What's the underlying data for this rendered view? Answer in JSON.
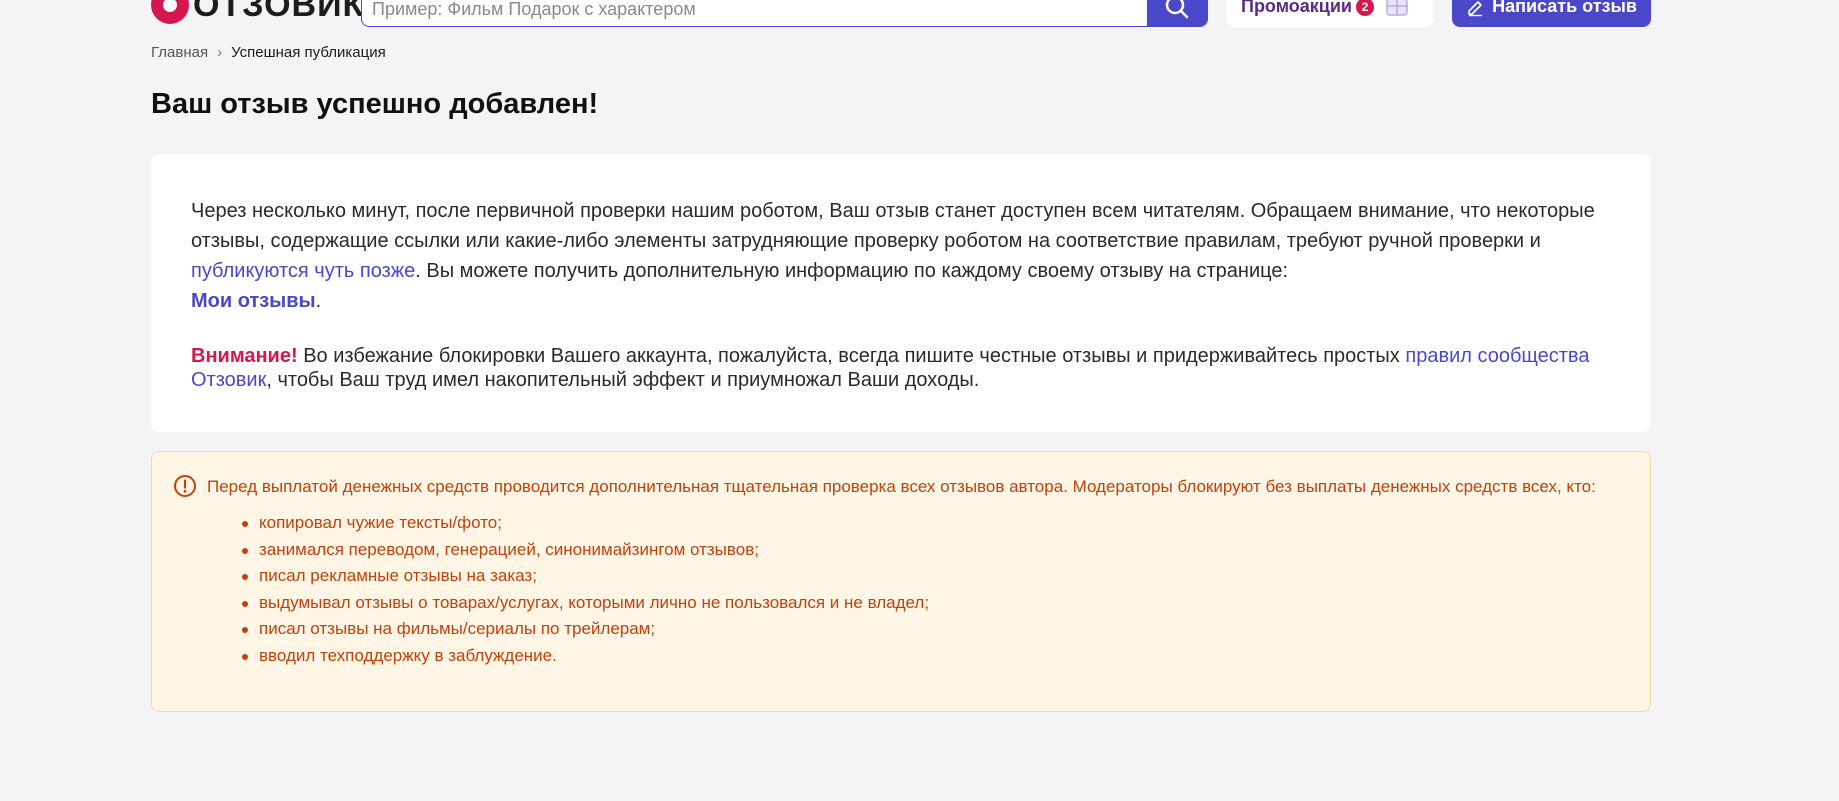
{
  "header": {
    "logo_text": "ОТЗОВИК",
    "search": {
      "placeholder": "Пример: Фильм Подарок с характером",
      "button_icon": "search-icon"
    },
    "promo": {
      "label": "Промоакции",
      "badge_count": "2",
      "icon": "gift-icon"
    },
    "write_button": {
      "label": "Написать отзыв",
      "icon": "pencil-icon"
    }
  },
  "breadcrumb": {
    "home": "Главная",
    "separator": "›",
    "current": "Успешная публикация"
  },
  "page_title": "Ваш отзыв успешно добавлен!",
  "success_card": {
    "para1_text1": "Через несколько минут, после первичной проверки нашим роботом, Ваш отзыв станет доступен всем читателям. Обращаем внимание, что некоторые отзывы, содержащие ссылки или какие-либо элементы затрудняющие проверку роботом на соответствие правилам, требуют ручной проверки и ",
    "para1_link1": "публикуются чуть позже",
    "para1_text2": ". Вы можете получить дополнительную информацию по каждому своему отзыву на странице: ",
    "para1_link2": "Мои отзывы",
    "para1_text3": ".",
    "attention_label": "Внимание!",
    "para2_text1": " Во избежание блокировки Вашего аккаунта, пожалуйста, всегда пишите честные отзывы и придерживайтесь простых ",
    "para2_link": "правил сообщества Отзовик",
    "para2_text2": ", чтобы Ваш труд имел накопительный эффект и приумножал Ваши доходы."
  },
  "warning": {
    "icon": "exclamation-circle-icon",
    "text": "Перед выплатой денежных средств проводится дополнительная тщательная проверка всех отзывов автора. Модераторы блокируют без выплаты денежных средств всех, кто:",
    "items": [
      "копировал чужие тексты/фото;",
      "занимался переводом, генерацией, синонимайзингом отзывов;",
      "писал рекламные отзывы на заказ;",
      "выдумывал отзывы о товарах/услугах, которыми лично не пользовался и не владел;",
      "писал отзывы на фильмы/сериалы по трейлерам;",
      "вводил техподдержку в заблуждение."
    ]
  },
  "colors": {
    "brand_red": "#d6174d",
    "accent_blue": "#4a48c8",
    "warning_text": "#c2410c",
    "warning_bg": "#fff6e6",
    "page_bg": "#f4f4f6"
  }
}
